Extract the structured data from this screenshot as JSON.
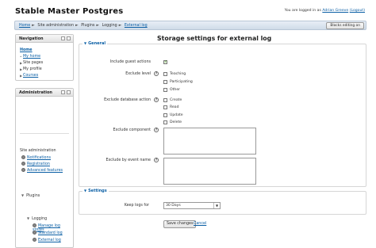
{
  "site": {
    "title": "Stable Master Postgres"
  },
  "login": {
    "prefix": "You are logged in as",
    "user": "Adrian Greeve",
    "logout": "(Logout)"
  },
  "breadcrumb": [
    "Home",
    "Site administration",
    "Plugins",
    "Logging",
    "External log"
  ],
  "header": {
    "blocks_button": "Blocks editing on"
  },
  "navigation": {
    "title": "Navigation",
    "home": "Home",
    "items": [
      "My home",
      "Site pages",
      "My profile",
      "Courses"
    ]
  },
  "administration": {
    "title": "Administration",
    "site_admin": "Site administration",
    "links": [
      "Notifications",
      "Registration",
      "Advanced features"
    ],
    "plugins": "Plugins",
    "logging": "Logging",
    "logging_children": [
      "Manage log stores",
      "Standard log",
      "External log"
    ]
  },
  "page": {
    "heading": "Storage settings for external log"
  },
  "general": {
    "legend": "General",
    "include_guest": {
      "label": "Include guest actions",
      "checked": true
    },
    "exclude_level": {
      "label": "Exclude level",
      "options": [
        "Teaching",
        "Participating",
        "Other"
      ]
    },
    "exclude_db_action": {
      "label": "Exclude database action",
      "options": [
        "Create",
        "Read",
        "Update",
        "Delete"
      ]
    },
    "exclude_component": {
      "label": "Exclude component",
      "value": ""
    },
    "exclude_event_name": {
      "label": "Exclude by event name",
      "value": ""
    }
  },
  "settings": {
    "legend": "Settings",
    "keep_logs": {
      "label": "Keep logs for",
      "value": "30 Days"
    }
  },
  "actions": {
    "save": "Save changes",
    "cancel": "Cancel"
  },
  "colors": {
    "link": "#0b5fa5",
    "navbar": "#cfdbe8"
  },
  "help_icon_glyph": "?",
  "tree_toggle_glyph": "▶"
}
